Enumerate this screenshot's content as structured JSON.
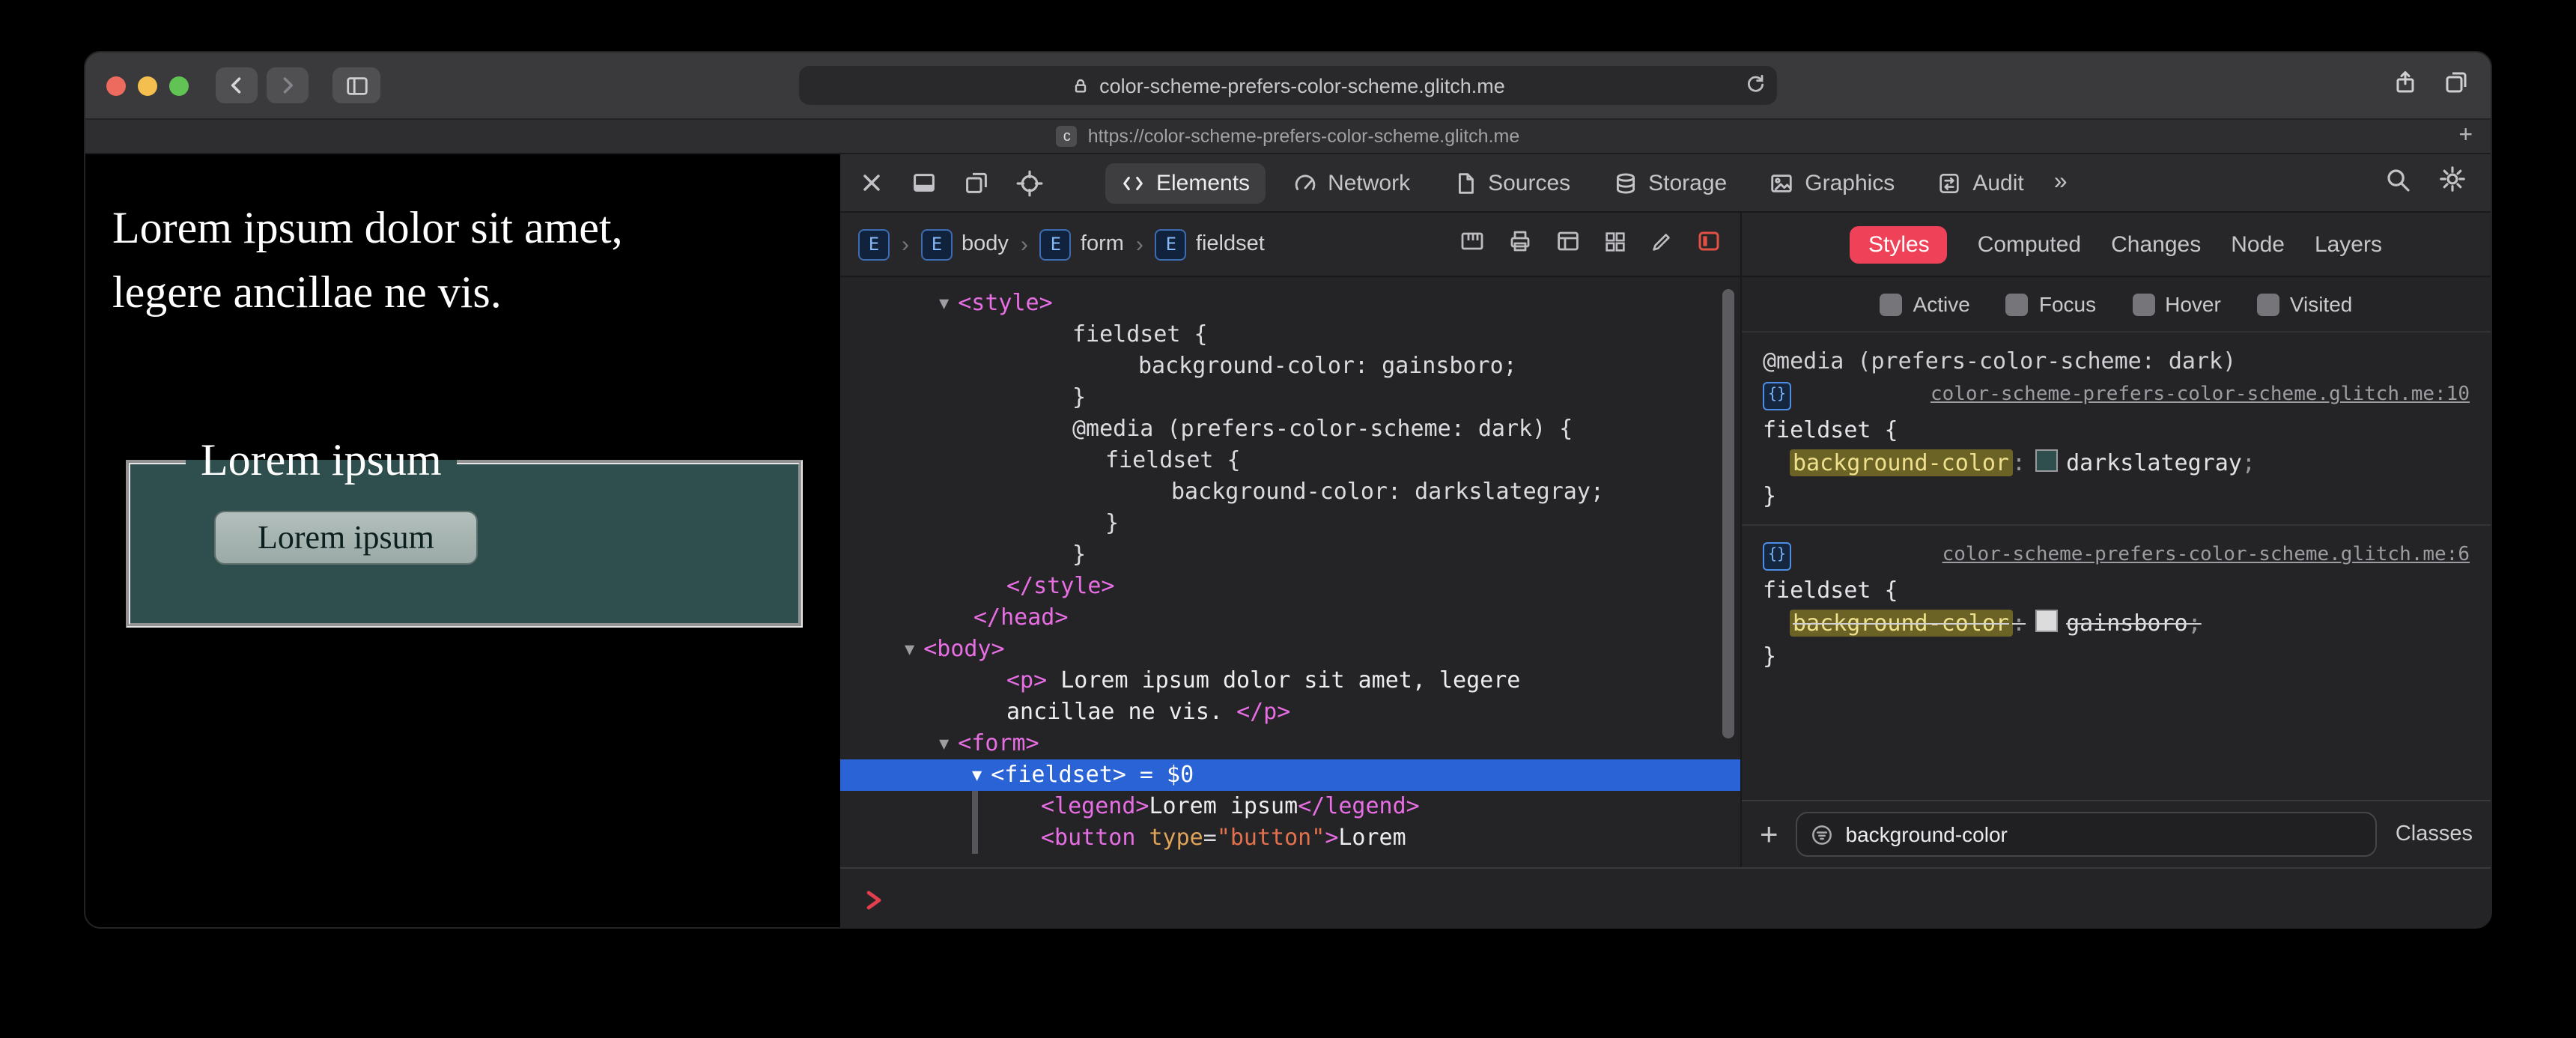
{
  "browser": {
    "address": "color-scheme-prefers-color-scheme.glitch.me",
    "tab_url": "https://color-scheme-prefers-color-scheme.glitch.me",
    "favicon_letter": "c",
    "new_tab_symbol": "+"
  },
  "page": {
    "paragraph_line1": "Lorem ipsum dolor sit amet,",
    "paragraph_line2": "legere ancillae ne vis.",
    "fieldset_legend": "Lorem ipsum",
    "button_label": "Lorem ipsum",
    "colors": {
      "page_bg": "#000000",
      "fieldset_bg": "#2f4f4f"
    }
  },
  "devtools": {
    "tabs": [
      {
        "label": "Elements",
        "active": true
      },
      {
        "label": "Network",
        "active": false
      },
      {
        "label": "Sources",
        "active": false
      },
      {
        "label": "Storage",
        "active": false
      },
      {
        "label": "Graphics",
        "active": false
      },
      {
        "label": "Audit",
        "active": false
      }
    ],
    "overflow_symbol": "»",
    "breadcrumbs": [
      {
        "letter": "E",
        "label": ""
      },
      {
        "letter": "E",
        "label": "body"
      },
      {
        "letter": "E",
        "label": "form"
      },
      {
        "letter": "E",
        "label": "fieldset"
      }
    ],
    "dom": {
      "lines": [
        {
          "ind": 66,
          "toks": [
            [
              "tri",
              "▼"
            ],
            [
              "tag",
              "<style>"
            ]
          ]
        },
        {
          "ind": 155,
          "toks": [
            [
              "css",
              "fieldset {"
            ]
          ]
        },
        {
          "ind": 199,
          "toks": [
            [
              "css",
              "background-color: gainsboro;"
            ]
          ]
        },
        {
          "ind": 155,
          "toks": [
            [
              "css",
              "}"
            ]
          ]
        },
        {
          "ind": 155,
          "toks": [
            [
              "css",
              "@media (prefers-color-scheme: dark) {"
            ]
          ]
        },
        {
          "ind": 177,
          "toks": [
            [
              "css",
              "fieldset {"
            ]
          ]
        },
        {
          "ind": 221,
          "toks": [
            [
              "css",
              "background-color: darkslategray;"
            ]
          ]
        },
        {
          "ind": 177,
          "toks": [
            [
              "css",
              "}"
            ]
          ]
        },
        {
          "ind": 155,
          "toks": [
            [
              "css",
              "}"
            ]
          ]
        },
        {
          "ind": 111,
          "toks": [
            [
              "tag",
              "</style>"
            ]
          ]
        },
        {
          "ind": 89,
          "toks": [
            [
              "tag",
              "</head>"
            ]
          ]
        },
        {
          "ind": 43,
          "toks": [
            [
              "tri",
              "▼"
            ],
            [
              "tag",
              "<body>"
            ]
          ]
        },
        {
          "ind": 111,
          "toks": [
            [
              "tag",
              "<p>"
            ],
            [
              "text",
              " Lorem ipsum dolor sit amet, legere"
            ]
          ]
        },
        {
          "ind": 111,
          "toks": [
            [
              "text",
              "ancillae ne vis. "
            ],
            [
              "tag",
              "</p>"
            ]
          ]
        },
        {
          "ind": 66,
          "toks": [
            [
              "tri",
              "▼"
            ],
            [
              "tag",
              "<form>"
            ]
          ]
        },
        {
          "ind": 88,
          "sel": true,
          "toks": [
            [
              "tri",
              "▼"
            ],
            [
              "tag",
              "<fieldset>"
            ],
            [
              "plain",
              " = $0"
            ]
          ]
        },
        {
          "ind": 134,
          "bar": true,
          "toks": [
            [
              "tag",
              "<legend>"
            ],
            [
              "text",
              "Lorem ipsum"
            ],
            [
              "tag",
              "</legend>"
            ]
          ]
        },
        {
          "ind": 134,
          "bar": true,
          "toks": [
            [
              "tag",
              "<button "
            ],
            [
              "attr",
              "type"
            ],
            [
              "css",
              "="
            ],
            [
              "str",
              "\"button\""
            ],
            [
              "tag",
              ">"
            ],
            [
              "text",
              "Lorem"
            ]
          ]
        }
      ]
    },
    "console_prompt_icon": "chevron-right",
    "styles": {
      "tabs": [
        "Styles",
        "Computed",
        "Changes",
        "Node",
        "Layers"
      ],
      "active_tab": "Styles",
      "pseudos": [
        "Active",
        "Focus",
        "Hover",
        "Visited"
      ],
      "media_query": "@media (prefers-color-scheme: dark)",
      "rules": [
        {
          "link": "color-scheme-prefers-color-scheme.glitch.me:10",
          "selector": "fieldset {",
          "property": "background-color",
          "colon": ": ",
          "value": "darkslategray",
          "semicolon": ";",
          "swatch": "#2f4f4f",
          "close": "}",
          "overridden": false
        },
        {
          "link": "color-scheme-prefers-color-scheme.glitch.me:6",
          "selector": "fieldset {",
          "property": "background-color",
          "colon": ": ",
          "value": "gainsboro",
          "semicolon": ";",
          "swatch": "#dcdcdc",
          "close": "}",
          "overridden": true
        }
      ],
      "goto_icon_symbol": "{}",
      "add_symbol": "+",
      "filter_value": "background-color",
      "classes_label": "Classes"
    }
  }
}
